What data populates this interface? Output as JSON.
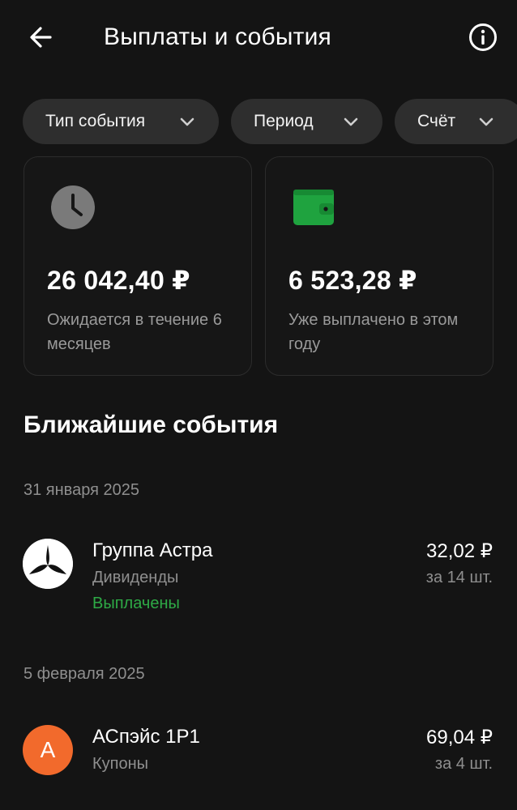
{
  "header": {
    "title": "Выплаты и события"
  },
  "filters": [
    {
      "label": "Тип события"
    },
    {
      "label": "Период"
    },
    {
      "label": "Счёт"
    }
  ],
  "summary": {
    "expected": {
      "amount": "26 042,40 ₽",
      "description": "Ожидается в течение 6 месяцев",
      "icon": "clock-icon",
      "icon_color": "#7a7a7a"
    },
    "paid": {
      "amount": "6 523,28 ₽",
      "description": "Уже выплачено в этом году",
      "icon": "wallet-icon",
      "icon_color": "#1fa33f"
    }
  },
  "upcoming": {
    "title": "Ближайшие события",
    "groups": [
      {
        "date": "31 января 2025",
        "events": [
          {
            "name": "Группа Астра",
            "type": "Дивиденды",
            "status": "Выплачены",
            "status_color": "#2eaa46",
            "amount": "32,02 ₽",
            "quantity": "за 14 шт.",
            "logo": "astra-logo"
          }
        ]
      },
      {
        "date": "5 февраля 2025",
        "events": [
          {
            "name": "АСпэйс 1Р1",
            "type": "Купоны",
            "amount": "69,04 ₽",
            "quantity": "за 4 шт.",
            "logo_letter": "А",
            "logo_color": "#f26a2c"
          }
        ]
      }
    ]
  }
}
